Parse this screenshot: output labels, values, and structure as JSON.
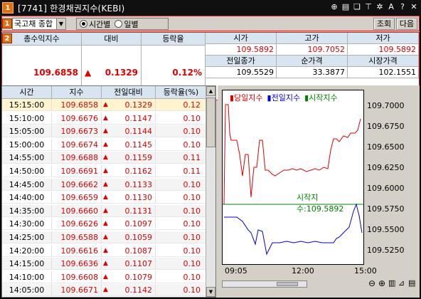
{
  "title": {
    "num": "1",
    "text": "[7741] 한경채권지수(KEBI)"
  },
  "toolbar": {
    "badge": "1",
    "combo_value": "국고채 종합",
    "radio_time": "시간별",
    "radio_day": "일별",
    "btn_query": "조회",
    "btn_next": "다음"
  },
  "summary": {
    "badge": "2",
    "h_index": "총수익지수",
    "h_change": "대비",
    "h_rate": "등락율",
    "v_index": "109.6858",
    "v_change": "0.1329",
    "v_rate": "0.12%",
    "h_open": "시가",
    "h_high": "고가",
    "h_low": "저가",
    "v_open": "109.5892",
    "v_high": "109.7052",
    "v_low": "109.5892",
    "h_prev": "전일종가",
    "h_net": "순가격",
    "h_mkt": "시장가격",
    "v_prev": "109.5529",
    "v_net": "33.3877",
    "v_mkt": "102.1551"
  },
  "table": {
    "headers": [
      "시간",
      "지수",
      "전일대비",
      "등락율(%)"
    ],
    "rows": [
      [
        "15:15:00",
        "109.6858",
        "0.1329",
        "0.12"
      ],
      [
        "15:10:00",
        "109.6676",
        "0.1147",
        "0.10"
      ],
      [
        "15:05:00",
        "109.6673",
        "0.1144",
        "0.10"
      ],
      [
        "15:00:00",
        "109.6674",
        "0.1145",
        "0.10"
      ],
      [
        "14:55:00",
        "109.6688",
        "0.1159",
        "0.11"
      ],
      [
        "14:50:00",
        "109.6691",
        "0.1162",
        "0.11"
      ],
      [
        "14:45:00",
        "109.6662",
        "0.1133",
        "0.10"
      ],
      [
        "14:40:00",
        "109.6659",
        "0.1130",
        "0.10"
      ],
      [
        "14:35:00",
        "109.6660",
        "0.1131",
        "0.10"
      ],
      [
        "14:30:00",
        "109.6626",
        "0.1097",
        "0.10"
      ],
      [
        "14:25:00",
        "109.6588",
        "0.1059",
        "0.10"
      ],
      [
        "14:20:00",
        "109.6616",
        "0.1087",
        "0.10"
      ],
      [
        "14:15:00",
        "109.6636",
        "0.1107",
        "0.10"
      ],
      [
        "14:10:00",
        "109.6608",
        "0.1079",
        "0.10"
      ],
      [
        "14:05:00",
        "109.6671",
        "0.1142",
        "0.10"
      ]
    ]
  },
  "chart_data": {
    "type": "line",
    "legend": [
      "당일지수",
      "전일지수",
      "시작지수"
    ],
    "start_label": "시작지수:109.5892",
    "yticks": [
      "109.7000",
      "109.6750",
      "109.6500",
      "109.6250",
      "109.6000",
      "109.5750",
      "109.5500",
      "109.5250"
    ],
    "xticks": [
      "09:05",
      "12:00",
      "15:00"
    ],
    "ylim": [
      109.5,
      109.71
    ],
    "start_value": 109.5892
  },
  "colors": {
    "up": "#e00000",
    "today": "#e00000",
    "prev": "#0000e0",
    "start": "#008000"
  }
}
